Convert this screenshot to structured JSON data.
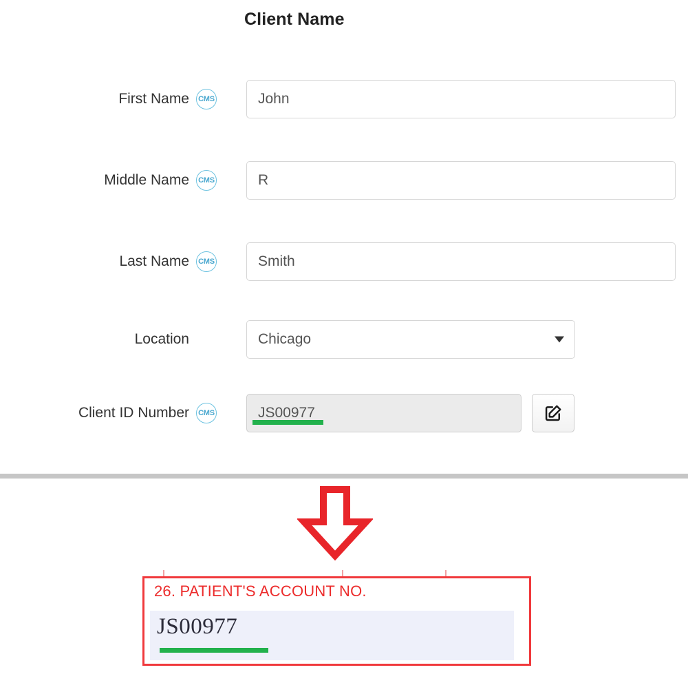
{
  "page": {
    "title": "Client Name"
  },
  "form": {
    "rows": [
      {
        "label": "First Name",
        "badge": "CMS",
        "badge_name": "cms-badge",
        "type": "text",
        "value": "John",
        "placeholder": ""
      },
      {
        "label": "Middle Name",
        "badge": "CMS",
        "badge_name": "cms-badge",
        "type": "text",
        "value": "R",
        "placeholder": ""
      },
      {
        "label": "Last Name",
        "badge": "CMS",
        "badge_name": "cms-badge",
        "type": "text",
        "value": "Smith",
        "placeholder": ""
      },
      {
        "label": "Location",
        "badge": "",
        "badge_name": "",
        "type": "select",
        "value": "Chicago",
        "options": [
          "Chicago"
        ]
      },
      {
        "label": "Client ID Number",
        "badge": "CMS",
        "badge_name": "cms-badge",
        "type": "readonly-with-edit",
        "value": "JS00977",
        "edit_icon": "pencil-square-icon"
      }
    ]
  },
  "callout": {
    "arrow_icon": "arrow-down-icon",
    "field_number_label": "26. PATIENT'S ACCOUNT NO.",
    "field_value": "JS00977"
  },
  "colors": {
    "accent_green": "#22b14c",
    "callout_red": "#f0393c",
    "callout_text_red": "#ec2b2b",
    "badge_blue": "#6cc2e0",
    "callout_field_bg": "#eef0fa",
    "divider_grey": "#c6c6c6",
    "readonly_bg": "#ebebeb"
  }
}
